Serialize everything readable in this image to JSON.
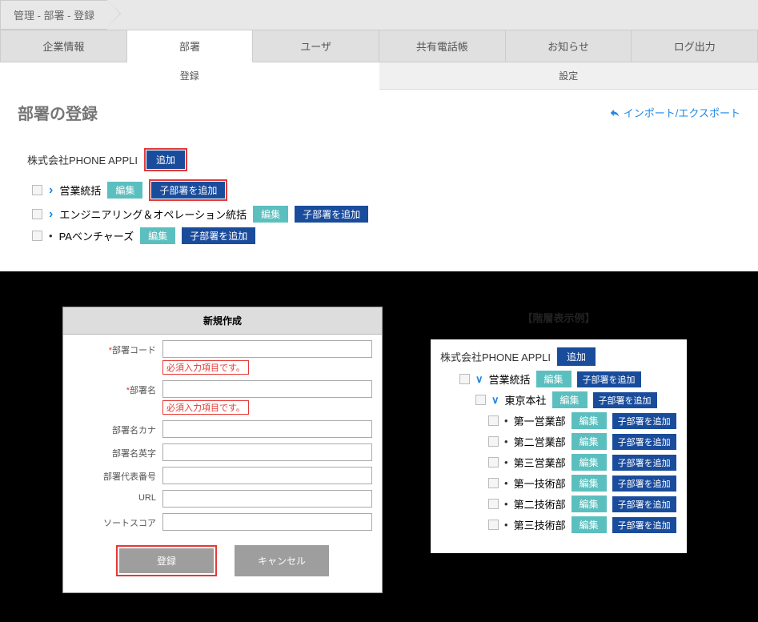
{
  "breadcrumb": "管理 - 部署 - 登録",
  "tabs1": {
    "items": [
      "企業情報",
      "部署",
      "ユーザ",
      "共有電話帳",
      "お知らせ",
      "ログ出力"
    ],
    "active": 1
  },
  "tabs2": {
    "items": [
      "登録",
      "設定"
    ],
    "active": 0
  },
  "page_title": "部署の登録",
  "impex": "インポート/エクスポート",
  "labels": {
    "add": "追加",
    "edit": "編集",
    "add_child": "子部署を追加"
  },
  "tree": {
    "root": "株式会社PHONE APPLI",
    "rows": [
      {
        "name": "営業統括",
        "expandable": true,
        "highlight": true
      },
      {
        "name": "エンジニアリング＆オペレーション統括",
        "expandable": true,
        "highlight": false
      },
      {
        "name": "PAベンチャーズ",
        "expandable": false,
        "highlight": false
      }
    ]
  },
  "dialog": {
    "title": "新規作成",
    "error": "必須入力項目です。",
    "submit": "登録",
    "cancel": "キャンセル",
    "fields": [
      {
        "label": "部署コード",
        "required": true,
        "error": true
      },
      {
        "label": "部署名",
        "required": true,
        "error": true
      },
      {
        "label": "部署名カナ",
        "required": false,
        "error": false
      },
      {
        "label": "部署名英字",
        "required": false,
        "error": false
      },
      {
        "label": "部署代表番号",
        "required": false,
        "error": false
      },
      {
        "label": "URL",
        "required": false,
        "error": false
      },
      {
        "label": "ソートスコア",
        "required": false,
        "error": false
      }
    ]
  },
  "example": {
    "title": "【階層表示例】",
    "root": "株式会社PHONE APPLI",
    "l1": {
      "name": "営業統括"
    },
    "l2": {
      "name": "東京本社"
    },
    "l3": [
      "第一営業部",
      "第二営業部",
      "第三営業部",
      "第一技術部",
      "第二技術部",
      "第三技術部"
    ]
  }
}
